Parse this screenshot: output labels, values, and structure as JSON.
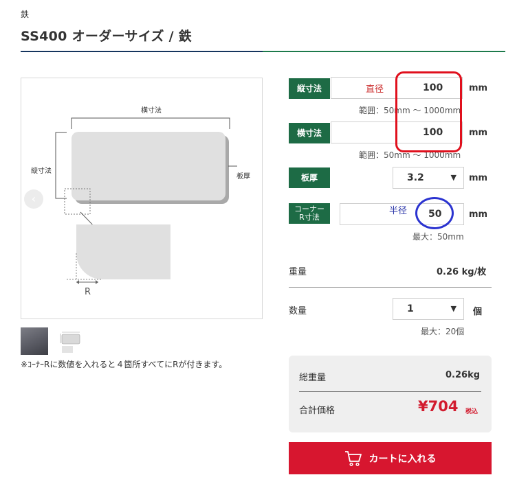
{
  "breadcrumb": "鉄",
  "title": "SS400 オーダーサイズ / 鉄",
  "preview": {
    "prev_icon": "chevron-left-icon",
    "labels": {
      "width": "横寸法",
      "height": "縦寸法",
      "thickness": "板厚",
      "radius": "R"
    }
  },
  "thumbnails": [
    "plate-photo",
    "plate-diagram"
  ],
  "note": "※ｺｰﾅｰRに数値を入れると４箇所すべてにRが付きます。",
  "form": {
    "height": {
      "label": "縦寸法",
      "value": "100",
      "unit": "mm",
      "hint": "範囲：50mm ～ 1000mm"
    },
    "width": {
      "label": "横寸法",
      "value": "100",
      "unit": "mm",
      "hint": "範囲：50mm ～ 1000mm"
    },
    "thickness": {
      "label": "板厚",
      "value": "3.2",
      "unit": "mm"
    },
    "corner": {
      "label_line1": "コーナー",
      "label_line2": "R寸法",
      "value": "50",
      "unit": "mm",
      "hint": "最大：50mm"
    }
  },
  "annotations": {
    "diameter": "直径",
    "radius": "半径"
  },
  "weight": {
    "label": "重量",
    "value": "0.26 kg/枚"
  },
  "quantity": {
    "label": "数量",
    "value": "1",
    "unit": "個",
    "hint": "最大：20個"
  },
  "summary": {
    "total_weight_label": "総重量",
    "total_weight_value": "0.26kg",
    "total_price_label": "合計価格",
    "total_price_value": "¥704",
    "tax_label": "税込"
  },
  "cart": {
    "label": "カートに入れる",
    "icon": "cart-icon"
  },
  "colors": {
    "green": "#1d6b45",
    "red": "#d7162f",
    "navy": "#15355e"
  }
}
